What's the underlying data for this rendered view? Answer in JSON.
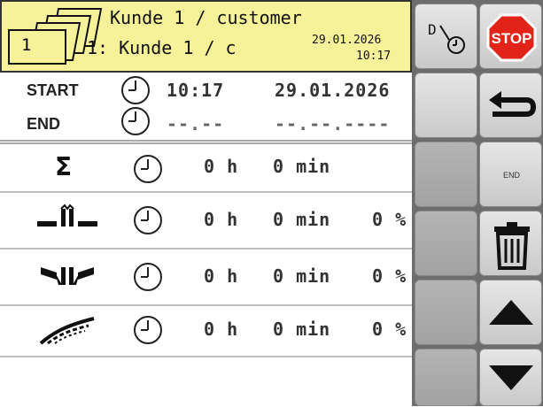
{
  "header": {
    "folder_number": "1",
    "customer_line1": "Kunde 1 / customer",
    "customer_line2": "1: Kunde 1 / c",
    "date": "29.01.2026",
    "time": "10:17",
    "icon": "customer-folders-icon"
  },
  "times": {
    "start_label": "START",
    "start_time": "10:17",
    "start_date": "29.01.2026",
    "end_label": "END",
    "end_time": "--.--",
    "end_date": "--.--.----"
  },
  "counters": [
    {
      "icon": "sigma-total-icon",
      "hours": "0 h",
      "minutes": "0 min",
      "percent": ""
    },
    {
      "icon": "spreading-center-icon",
      "hours": "0 h",
      "minutes": "0 min",
      "percent": "0 %"
    },
    {
      "icon": "spreading-sides-icon",
      "hours": "0 h",
      "minutes": "0 min",
      "percent": "0 %"
    },
    {
      "icon": "border-spreading-icon",
      "hours": "0 h",
      "minutes": "0 min",
      "percent": "0 %"
    }
  ],
  "softkeys": [
    {
      "name": "date-time-settings-button",
      "icon": "date-clock-icon"
    },
    {
      "name": "stop-button",
      "label": "STOP",
      "color": "#e2231a"
    },
    {
      "name": "empty-softkey-1",
      "icon": ""
    },
    {
      "name": "back-button",
      "icon": "return-arrow-icon"
    },
    {
      "name": "empty-softkey-2",
      "icon": ""
    },
    {
      "name": "end-button",
      "label": "END"
    },
    {
      "name": "empty-softkey-3",
      "icon": ""
    },
    {
      "name": "delete-button",
      "icon": "trash-icon"
    },
    {
      "name": "empty-softkey-4",
      "icon": ""
    },
    {
      "name": "scroll-up-button",
      "icon": "arrow-up-icon"
    },
    {
      "name": "empty-softkey-5",
      "icon": ""
    },
    {
      "name": "scroll-down-button",
      "icon": "arrow-down-icon"
    }
  ],
  "colors": {
    "header_bg": "#f6f29a",
    "panel_bg": "#6d6d6d",
    "stop_red": "#e2231a"
  }
}
